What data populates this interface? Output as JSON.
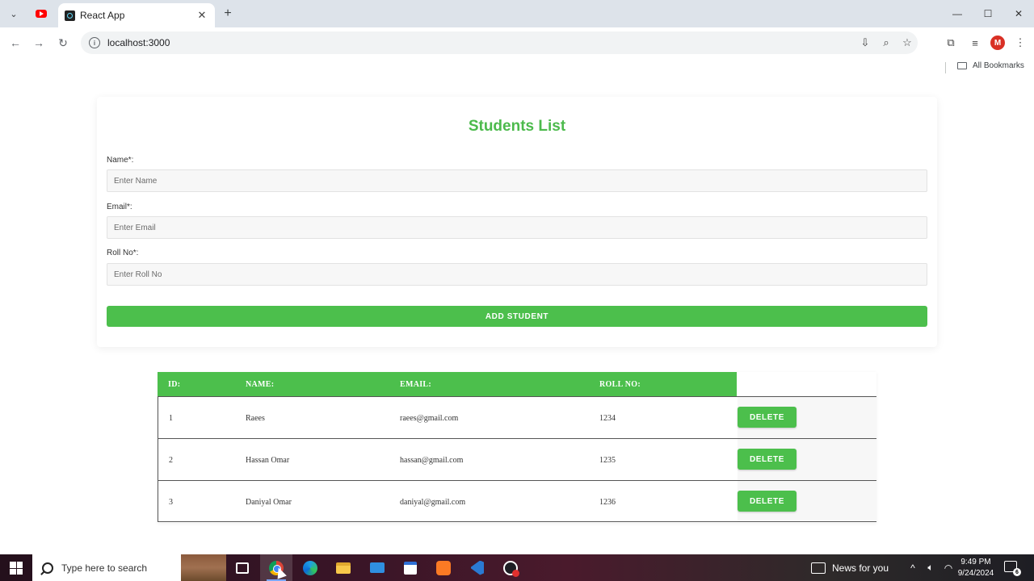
{
  "browser": {
    "tabs": [
      {
        "title": "React App",
        "favicon": "react-icon",
        "active": true
      }
    ],
    "pinned_tab_icon": "youtube-icon",
    "url": "localhost:3000",
    "profile_initial": "M",
    "profile_color": "#d93025",
    "bookmarks_label": "All Bookmarks"
  },
  "page": {
    "title": "Students List",
    "accent_color": "#4cbf4c",
    "form": {
      "name_label": "Name*:",
      "name_placeholder": "Enter Name",
      "email_label": "Email*:",
      "email_placeholder": "Enter Email",
      "roll_label": "Roll No*:",
      "roll_placeholder": "Enter Roll No",
      "submit_label": "ADD STUDENT"
    },
    "table": {
      "headers": [
        "ID:",
        "NAME:",
        "EMAIL:",
        "ROLL NO:"
      ],
      "rows": [
        {
          "id": "1",
          "name": "Raees",
          "email": "raees@gmail.com",
          "roll": "1234",
          "action": "DELETE"
        },
        {
          "id": "2",
          "name": "Hassan Omar",
          "email": "hassan@gmail.com",
          "roll": "1235",
          "action": "DELETE"
        },
        {
          "id": "3",
          "name": "Daniyal Omar",
          "email": "daniyal@gmail.com",
          "roll": "1236",
          "action": "DELETE"
        }
      ]
    }
  },
  "taskbar": {
    "search_placeholder": "Type here to search",
    "apps": [
      "task-view-icon",
      "chrome-icon",
      "edge-icon",
      "file-explorer-icon",
      "mail-icon",
      "store-icon",
      "xampp-icon",
      "vscode-icon",
      "performance-monitor-icon"
    ],
    "active_app": "chrome-icon",
    "news_label": "News for you",
    "time": "9:49 PM",
    "date": "9/24/2024",
    "notification_count": "6"
  }
}
